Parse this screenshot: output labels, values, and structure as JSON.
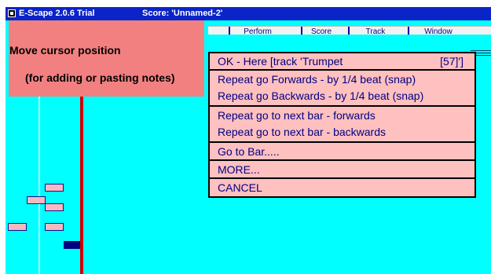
{
  "titlebar": {
    "app_title": "E-Scape 2.0.6 Trial",
    "score_label": "Score: 'Unnamed-2'"
  },
  "menubar": {
    "items": [
      {
        "label": "Perform"
      },
      {
        "label": "Score"
      },
      {
        "label": "Track"
      },
      {
        "label": "Window"
      }
    ]
  },
  "tooltip": {
    "line1": "Move cursor position",
    "line2": "(for adding or pasting notes)"
  },
  "popup": {
    "ok_label": "OK - Here   [track 'Trumpet",
    "ok_value": "[57]']",
    "repeat_forwards": "Repeat go Forwards   - by 1/4 beat (snap)",
    "repeat_backwards": "Repeat go Backwards - by 1/4 beat (snap)",
    "next_bar_forwards": "Repeat go to next bar - forwards",
    "next_bar_backwards": "Repeat go to next bar - backwards",
    "go_to_bar": "Go to Bar.....",
    "more": "MORE...",
    "cancel": "CANCEL"
  },
  "colors": {
    "workspace": "#00ffff",
    "titlebar": "#0a24c8",
    "tooltip": "#f28080",
    "popup": "#ffc0c0",
    "cursor_line": "#cc0000",
    "note_fill": "#f8b8c0",
    "selected_note": "#000080"
  },
  "icons": {
    "app_icon": "app-icon"
  }
}
